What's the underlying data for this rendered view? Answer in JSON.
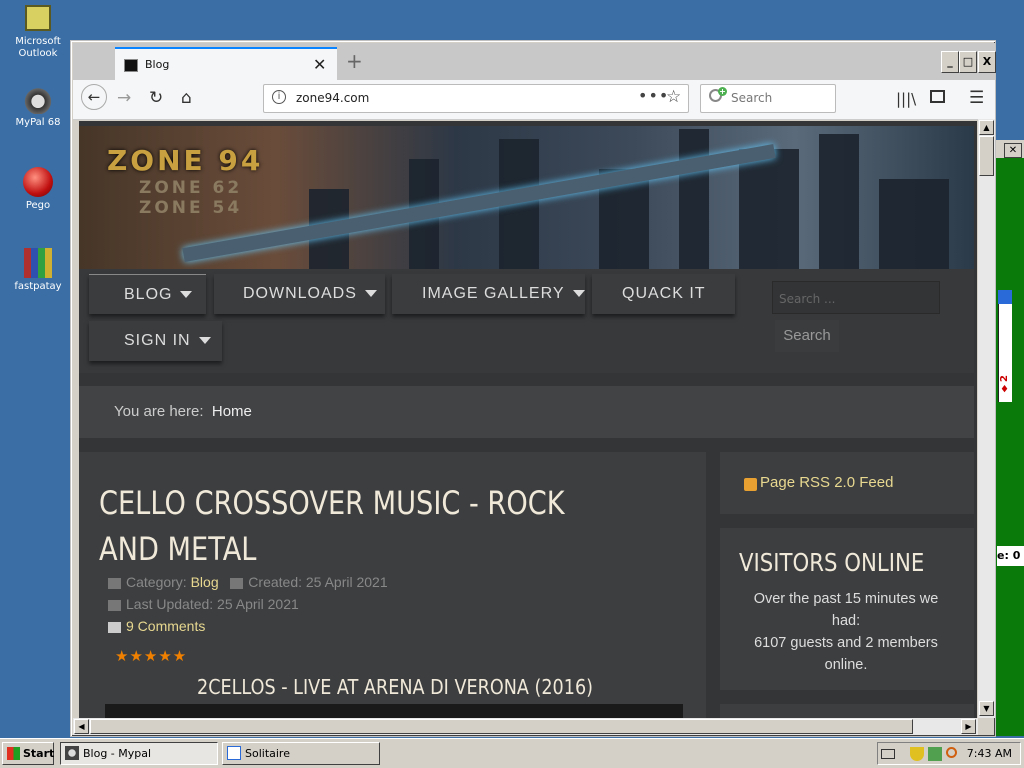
{
  "desktop": {
    "icons": [
      {
        "label": "Microsoft Outlook",
        "icon": "outlook-icon"
      },
      {
        "label": "MyPal 68",
        "icon": "mypal-icon"
      },
      {
        "label": "Pego",
        "icon": "pego-icon"
      },
      {
        "label": "fastpatay",
        "icon": "archive-icon"
      }
    ]
  },
  "browser": {
    "tab_title": "Blog",
    "url": "zone94.com",
    "search_placeholder": "Search",
    "window_buttons": {
      "minimize": "_",
      "maximize": "□",
      "close": "X"
    }
  },
  "site": {
    "logo": {
      "main": "ZONE 94",
      "sub1": "ZONE 62",
      "sub2": "ZONE 54"
    },
    "menu": [
      {
        "label": "BLOG",
        "has_dropdown": true
      },
      {
        "label": "DOWNLOADS",
        "has_dropdown": true
      },
      {
        "label": "IMAGE GALLERY",
        "has_dropdown": true
      },
      {
        "label": "QUACK IT",
        "has_dropdown": false
      },
      {
        "label": "SIGN IN",
        "has_dropdown": true
      }
    ],
    "search_placeholder": "Search ...",
    "search_button": "Search",
    "breadcrumb_prefix": "You are here:",
    "breadcrumb_current": "Home",
    "article": {
      "title": "CELLO CROSSOVER MUSIC - ROCK AND METAL",
      "category_label": "Category:",
      "category": "Blog",
      "created": "Created: 25 April 2021",
      "updated": "Last Updated: 25 April 2021",
      "comments": "9 Comments",
      "stars": "★★★★★",
      "video_title": "2CELLOS - LIVE AT ARENA DI VERONA (2016)"
    },
    "rss_label": "Page RSS 2.0 Feed",
    "visitors": {
      "heading": "VISITORS ONLINE",
      "text_1": "Over the past 15 minutes we had:",
      "text_2": "6107 guests and 2 members online."
    }
  },
  "solitaire": {
    "score": "e: 0"
  },
  "taskbar": {
    "start": "Start",
    "tasks": [
      "Blog - Mypal",
      "Solitaire"
    ],
    "clock": "7:43 AM"
  }
}
